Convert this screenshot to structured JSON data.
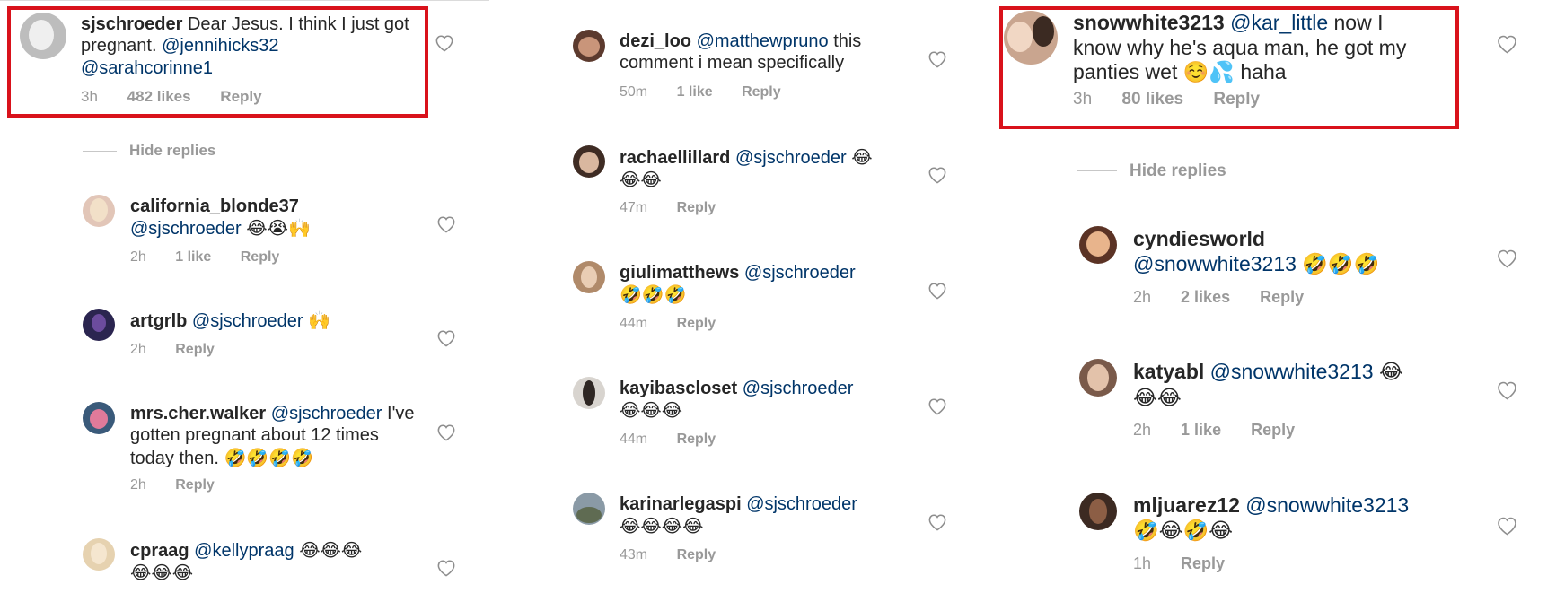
{
  "colors": {
    "highlight": "#d9121b",
    "mention": "#003569",
    "meta": "#999999"
  },
  "panel1": {
    "main": {
      "username": "sjschroeder",
      "text": "Dear Jesus. I think I just got pregnant.",
      "mention1": "@jennihicks32",
      "mention2": "@sarahcorinne1",
      "time": "3h",
      "likes": "482 likes",
      "reply": "Reply"
    },
    "hide_replies": "Hide replies",
    "replies": [
      {
        "username": "california_blonde37",
        "mention": "@sjschroeder",
        "emoji": "😂😭🙌",
        "time": "2h",
        "likes": "1 like",
        "reply": "Reply"
      },
      {
        "username": "artgrlb",
        "mention": "@sjschroeder",
        "emoji": "🙌",
        "time": "2h",
        "reply": "Reply"
      },
      {
        "username": "mrs.cher.walker",
        "mention": "@sjschroeder",
        "text": "I've gotten pregnant about 12 times today then.",
        "emoji": "🤣🤣🤣🤣",
        "time": "2h",
        "reply": "Reply"
      },
      {
        "username": "cpraag",
        "mention": "@kellypraag",
        "emoji": "😂😂😂",
        "emoji2": "😂😂😂"
      }
    ]
  },
  "panel2": {
    "items": [
      {
        "username": "dezi_loo",
        "mention": "@matthewpruno",
        "text": "this comment i mean specifically",
        "time": "50m",
        "likes": "1 like",
        "reply": "Reply"
      },
      {
        "username": "rachaellillard",
        "mention": "@sjschroeder",
        "emoji": "😂",
        "emoji2": "😂😂",
        "time": "47m",
        "reply": "Reply"
      },
      {
        "username": "giulimatthews",
        "mention": "@sjschroeder",
        "emoji": "🤣🤣🤣",
        "time": "44m",
        "reply": "Reply"
      },
      {
        "username": "kayibascloset",
        "mention": "@sjschroeder",
        "emoji": "😂😂😂",
        "time": "44m",
        "reply": "Reply"
      },
      {
        "username": "karinarlegaspi",
        "mention": "@sjschroeder",
        "emoji": "😂😂😂😂",
        "time": "43m",
        "reply": "Reply"
      }
    ]
  },
  "panel3": {
    "main": {
      "username": "snowwhite3213",
      "mention": "@kar_little",
      "text1": "now I",
      "text2": "know why he's aqua man, he got my",
      "text3": "panties wet",
      "emoji": "☺️💦",
      "text4": "haha",
      "time": "3h",
      "likes": "80 likes",
      "reply": "Reply"
    },
    "hide_replies": "Hide replies",
    "replies": [
      {
        "username": "cyndiesworld",
        "mention": "@snowwhite3213",
        "emoji": "🤣🤣🤣",
        "time": "2h",
        "likes": "2 likes",
        "reply": "Reply"
      },
      {
        "username": "katyabl",
        "mention": "@snowwhite3213",
        "emoji": "😂",
        "emoji2": "😂😂",
        "time": "2h",
        "likes": "1 like",
        "reply": "Reply"
      },
      {
        "username": "mljuarez12",
        "mention": "@snowwhite3213",
        "emoji": "🤣😂🤣😂",
        "time": "1h",
        "reply": "Reply"
      }
    ]
  }
}
